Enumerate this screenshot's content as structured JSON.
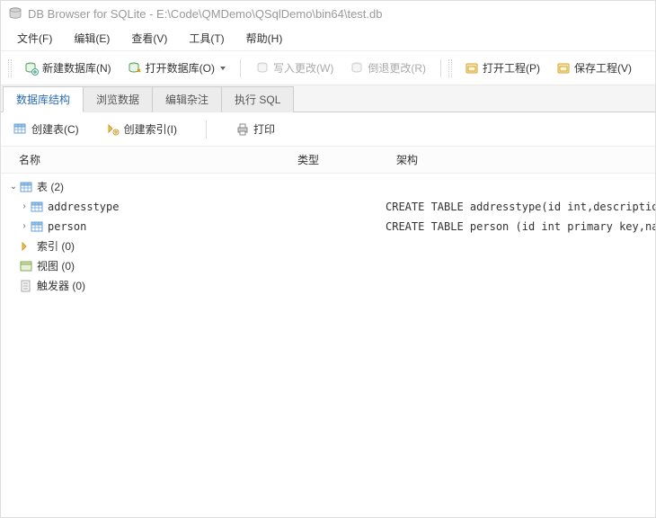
{
  "window": {
    "title": "DB Browser for SQLite - E:\\Code\\QMDemo\\QSqlDemo\\bin64\\test.db"
  },
  "menu": {
    "file": "文件(F)",
    "edit": "编辑(E)",
    "view": "查看(V)",
    "tools": "工具(T)",
    "help": "帮助(H)"
  },
  "toolbar": {
    "new_db": "新建数据库(N)",
    "open_db": "打开数据库(O)",
    "write_changes": "写入更改(W)",
    "revert_changes": "倒退更改(R)",
    "open_project": "打开工程(P)",
    "save_project": "保存工程(V)"
  },
  "tabs": {
    "structure": "数据库结构",
    "browse": "浏览数据",
    "pragmas": "编辑杂注",
    "sql": "执行 SQL"
  },
  "subtoolbar": {
    "create_table": "创建表(C)",
    "create_index": "创建索引(I)",
    "print": "打印"
  },
  "tree_header": {
    "name": "名称",
    "type": "类型",
    "schema": "架构"
  },
  "tree": {
    "tables_label": "表 (2)",
    "table1_name": "addresstype",
    "table1_schema": "CREATE TABLE addresstype(id int,description v",
    "table2_name": "person",
    "table2_schema": "CREATE TABLE person (id int primary key,name ",
    "indices_label": "索引 (0)",
    "views_label": "视图 (0)",
    "triggers_label": "触发器 (0)"
  }
}
